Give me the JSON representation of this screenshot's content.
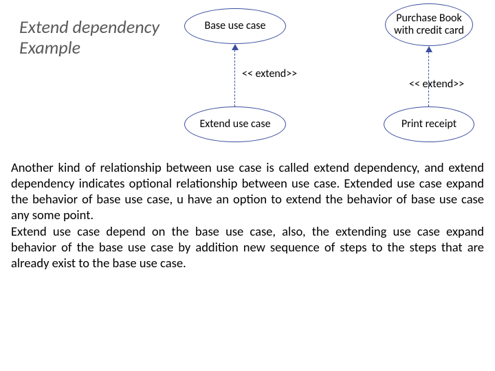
{
  "title_line1": "Extend dependency",
  "title_line2": "Example",
  "usecases": {
    "base": "Base use case",
    "extend": "Extend use case",
    "purchase": "Purchase Book with credit card",
    "print": "Print receipt"
  },
  "stereotype": {
    "left": "<< extend>>",
    "right": "<< extend>>"
  },
  "paragraph1": "Another kind of relationship between use case is called extend dependency, and extend dependency indicates optional relationship between  use case. Extended use case expand the behavior of base use case, u have an option to extend the behavior of base use case any some point.",
  "paragraph2": "Extend use case depend on the base use case, also, the extending use case expand behavior of the base use case by addition new sequence of steps to the steps that are already exist to the base use case."
}
